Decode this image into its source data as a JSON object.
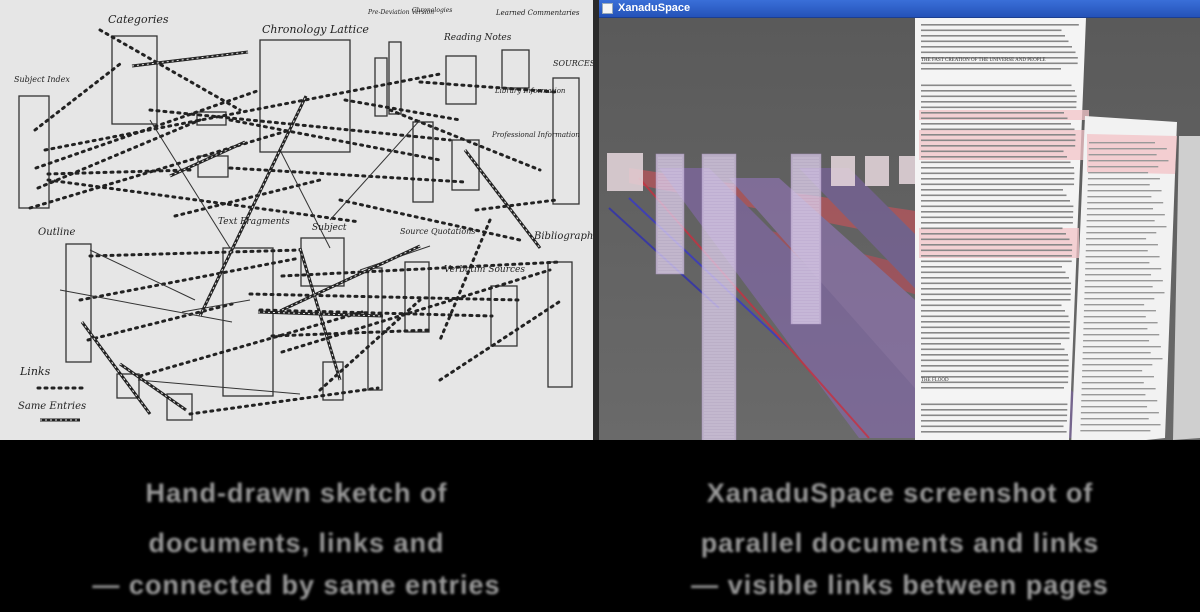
{
  "left_panel": {
    "description_kind": "hand-drawn sketch of parallel documents and links",
    "labels": {
      "categories": "Categories",
      "chronology_lattice": "Chronology Lattice",
      "deviation_version": "Pre-Deviation Version",
      "chronologies": "Chronologies",
      "reading_notes": "Reading Notes",
      "learned_commentaries": "Learned Commentaries",
      "sources": "SOURCES",
      "subject_index": "Subject Index",
      "library_information": "Library Information",
      "professional_information": "Professional Information",
      "outline": "Outline",
      "text_fragments": "Text Fragments",
      "subject": "Subject",
      "source_quotations": "Source Quotations",
      "verbatim_sources": "Verbatim Sources",
      "bibliography": "Bibliography",
      "links_legend": "Links",
      "same_entries_legend": "Same Entries"
    }
  },
  "right_panel": {
    "window_title": "XanaduSpace",
    "document_headings": {
      "fast_creation": "THE FAST CREATION OF THE UNIVERSE AND PEOPLE",
      "flood": "THE FLOOD"
    },
    "accent_colors": {
      "link_red": "#d8505a",
      "link_blue": "#3838c8",
      "link_purple": "#8a6ab8",
      "window_blue": "#2452b8"
    }
  },
  "caption": {
    "left_lines": [
      "Hand-drawn sketch of",
      "documents, links and",
      "— connected by same entries"
    ],
    "right_lines": [
      "XanaduSpace screenshot of",
      "parallel documents and links",
      "— visible links between pages"
    ]
  }
}
